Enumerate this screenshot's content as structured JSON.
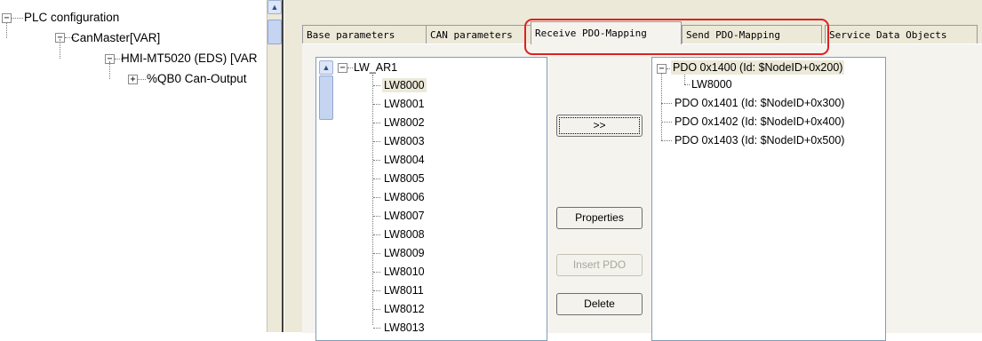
{
  "left_tree": {
    "root": "PLC configuration",
    "can_master": "CanMaster[VAR]",
    "hmi": "HMI-MT5020 (EDS)  [VAR",
    "output": "%QB0 Can-Output"
  },
  "tabs": [
    {
      "label": "Base parameters"
    },
    {
      "label": "CAN parameters"
    },
    {
      "label": "Receive PDO-Mapping"
    },
    {
      "label": "Send PDO-Mapping"
    },
    {
      "label": "Service Data Objects"
    }
  ],
  "active_tab": "Receive PDO-Mapping",
  "source_list": {
    "root": "LW_AR1",
    "items": [
      "LW8000",
      "LW8001",
      "LW8002",
      "LW8003",
      "LW8004",
      "LW8005",
      "LW8006",
      "LW8007",
      "LW8008",
      "LW8009",
      "LW8010",
      "LW8011",
      "LW8012",
      "LW8013"
    ],
    "selected": "LW8000"
  },
  "buttons": {
    "add": ">>",
    "properties": "Properties",
    "insert_pdo": "Insert PDO",
    "delete": "Delete"
  },
  "pdo_list": [
    {
      "label": "PDO 0x1400 (Id: $NodeID+0x200)",
      "children": [
        "LW8000"
      ]
    },
    {
      "label": "PDO 0x1401 (Id: $NodeID+0x300)",
      "children": []
    },
    {
      "label": "PDO 0x1402 (Id: $NodeID+0x400)",
      "children": []
    },
    {
      "label": "PDO 0x1403 (Id: $NodeID+0x500)",
      "children": []
    }
  ],
  "colors": {
    "highlight": "#e02020",
    "panel": "#ece9d8",
    "selection": "#ece9d8"
  }
}
